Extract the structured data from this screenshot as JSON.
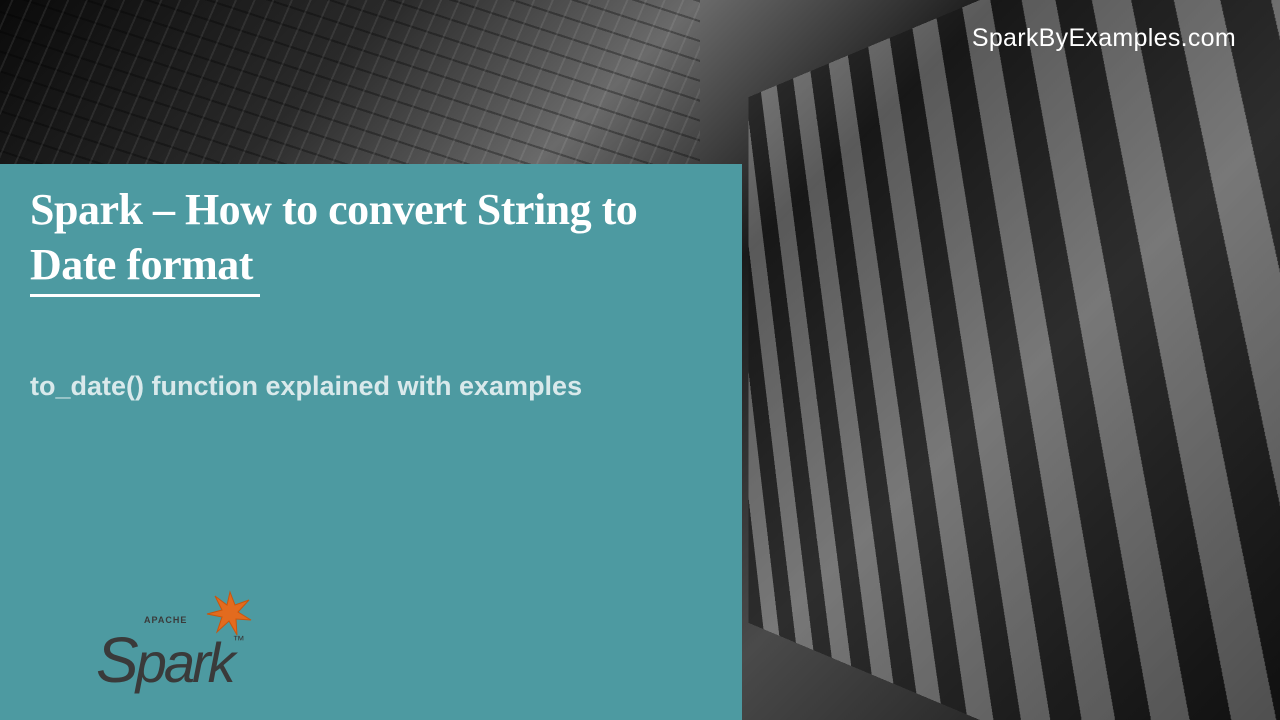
{
  "site": {
    "label": "SparkByExamples.com"
  },
  "panel": {
    "title": "Spark – How to convert String to Date format",
    "subtitle": "to_date() function explained with examples"
  },
  "logo": {
    "apache": "APACHE",
    "word_cap": "S",
    "word_rest": "park",
    "tm": "™"
  },
  "colors": {
    "panel_bg": "#4d9aa1",
    "accent": "#e36b1e"
  }
}
